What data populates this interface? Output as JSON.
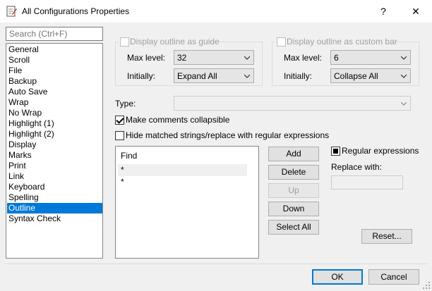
{
  "window": {
    "title": "All Configurations Properties",
    "help_label": "?",
    "close_label": "✕"
  },
  "sidebar": {
    "search_placeholder": "Search (Ctrl+F)",
    "items": [
      {
        "label": "General",
        "selected": false
      },
      {
        "label": "Scroll",
        "selected": false
      },
      {
        "label": "File",
        "selected": false
      },
      {
        "label": "Backup",
        "selected": false
      },
      {
        "label": "Auto Save",
        "selected": false
      },
      {
        "label": "Wrap",
        "selected": false
      },
      {
        "label": "No Wrap",
        "selected": false
      },
      {
        "label": "Highlight (1)",
        "selected": false
      },
      {
        "label": "Highlight (2)",
        "selected": false
      },
      {
        "label": "Display",
        "selected": false
      },
      {
        "label": "Marks",
        "selected": false
      },
      {
        "label": "Print",
        "selected": false
      },
      {
        "label": "Link",
        "selected": false
      },
      {
        "label": "Keyboard",
        "selected": false
      },
      {
        "label": "Spelling",
        "selected": false
      },
      {
        "label": "Outline",
        "selected": true
      },
      {
        "label": "Syntax Check",
        "selected": false
      }
    ]
  },
  "outline_guide": {
    "checkbox_label": "Display outline as guide",
    "max_level_label": "Max level:",
    "max_level_value": "32",
    "initially_label": "Initially:",
    "initially_value": "Expand All"
  },
  "outline_bar": {
    "checkbox_label": "Display outline as custom bar",
    "max_level_label": "Max level:",
    "max_level_value": "6",
    "initially_label": "Initially:",
    "initially_value": "Collapse All"
  },
  "type": {
    "label": "Type:",
    "value": ""
  },
  "options": {
    "make_comments_label": "Make comments collapsible",
    "make_comments_checked": true,
    "hide_matched_label": "Hide matched strings/replace with regular expressions",
    "hide_matched_checked": false
  },
  "find_list": {
    "header": "Find",
    "rows": [
      "*",
      "*"
    ]
  },
  "buttons": {
    "add": "Add",
    "delete": "Delete",
    "up": "Up",
    "down": "Down",
    "select_all": "Select All",
    "reset": "Reset...",
    "ok": "OK",
    "cancel": "Cancel"
  },
  "regex": {
    "label": "Regular expressions",
    "checked": true,
    "replace_with_label": "Replace with:",
    "replace_with_value": ""
  },
  "colors": {
    "selection": "#0078d7",
    "dialog_bg": "#f0f0f0"
  }
}
